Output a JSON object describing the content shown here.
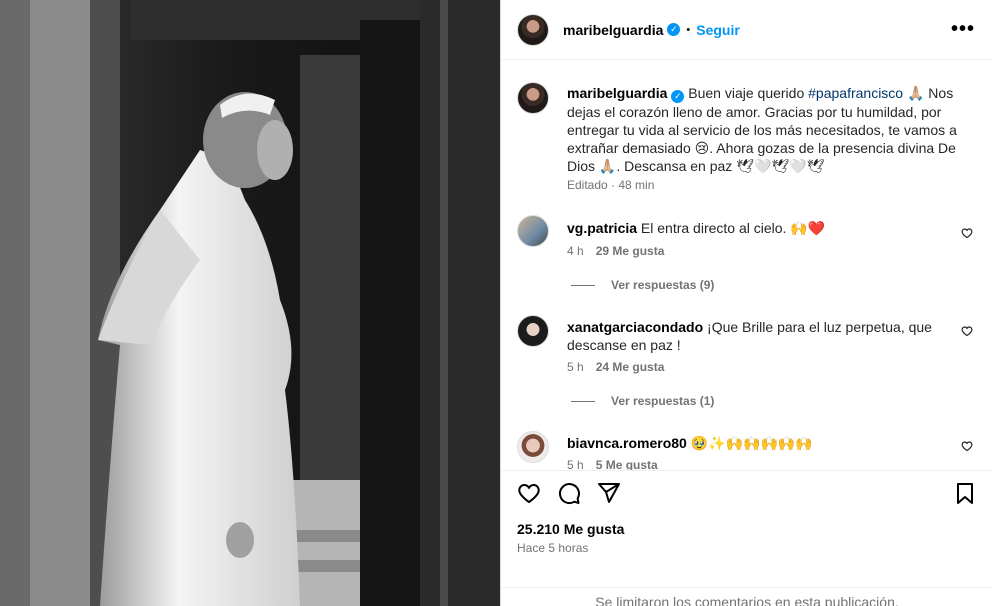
{
  "post": {
    "username": "maribelguardia",
    "follow_label": "Seguir",
    "more_label": "•••",
    "separator": "•"
  },
  "caption": {
    "username": "maribelguardia",
    "text_before": "Buen viaje querido ",
    "hashtag": "#papafrancisco",
    "text_after": " 🙏🏼 Nos dejas el corazón lleno de amor. Gracias por tu humildad, por entregar tu vida al servicio de los más necesitados, te vamos a extrañar demasiado 😢. Ahora gozas de la presencia divina De Dios 🙏🏼. Descansa en paz 🕊🤍🕊🤍🕊",
    "edited": "Editado · 48 min"
  },
  "comments": [
    {
      "username": "vg.patricia",
      "text": "El entra directo al cielo. 🙌❤️",
      "time": "4 h",
      "likes": "29 Me gusta",
      "replies": "Ver respuestas (9)"
    },
    {
      "username": "xanatgarciacondado",
      "text": "¡Que Brille para el luz perpetua, que descanse en paz !",
      "time": "5 h",
      "likes": "24 Me gusta",
      "replies": "Ver respuestas (1)"
    },
    {
      "username": "biavnca.romero80",
      "text": "🥹✨🙌🙌🙌🙌🙌",
      "time": "5 h",
      "likes": "5 Me gusta"
    }
  ],
  "footer": {
    "likes": "25.210 Me gusta",
    "time": "Hace 5 horas",
    "comments_closed": "Se limitaron los comentarios en esta publicación."
  },
  "colors": {
    "link": "#0095f6",
    "muted": "#737373"
  }
}
